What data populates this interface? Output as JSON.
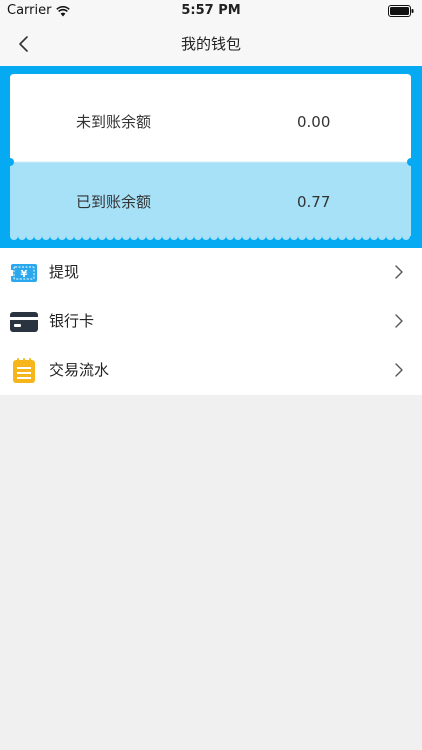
{
  "status_bar": {
    "carrier": "Carrier",
    "time": "5:57 PM"
  },
  "nav": {
    "title": "我的钱包",
    "back_icon": "chevron-left-icon"
  },
  "balances": {
    "pending_label": "未到账余额",
    "pending_value": "0.00",
    "settled_label": "已到账余额",
    "settled_value": "0.77"
  },
  "menu": {
    "items": [
      {
        "label": "提现",
        "icon": "withdraw-icon"
      },
      {
        "label": "银行卡",
        "icon": "bank-card-icon"
      },
      {
        "label": "交易流水",
        "icon": "transactions-notepad-icon"
      }
    ]
  },
  "colors": {
    "accent": "#06aaf2",
    "settled_row": "#a6e1f8",
    "notepad": "#f7b51c",
    "card_icon": "#2a3340",
    "background": "#f0f0f0"
  }
}
